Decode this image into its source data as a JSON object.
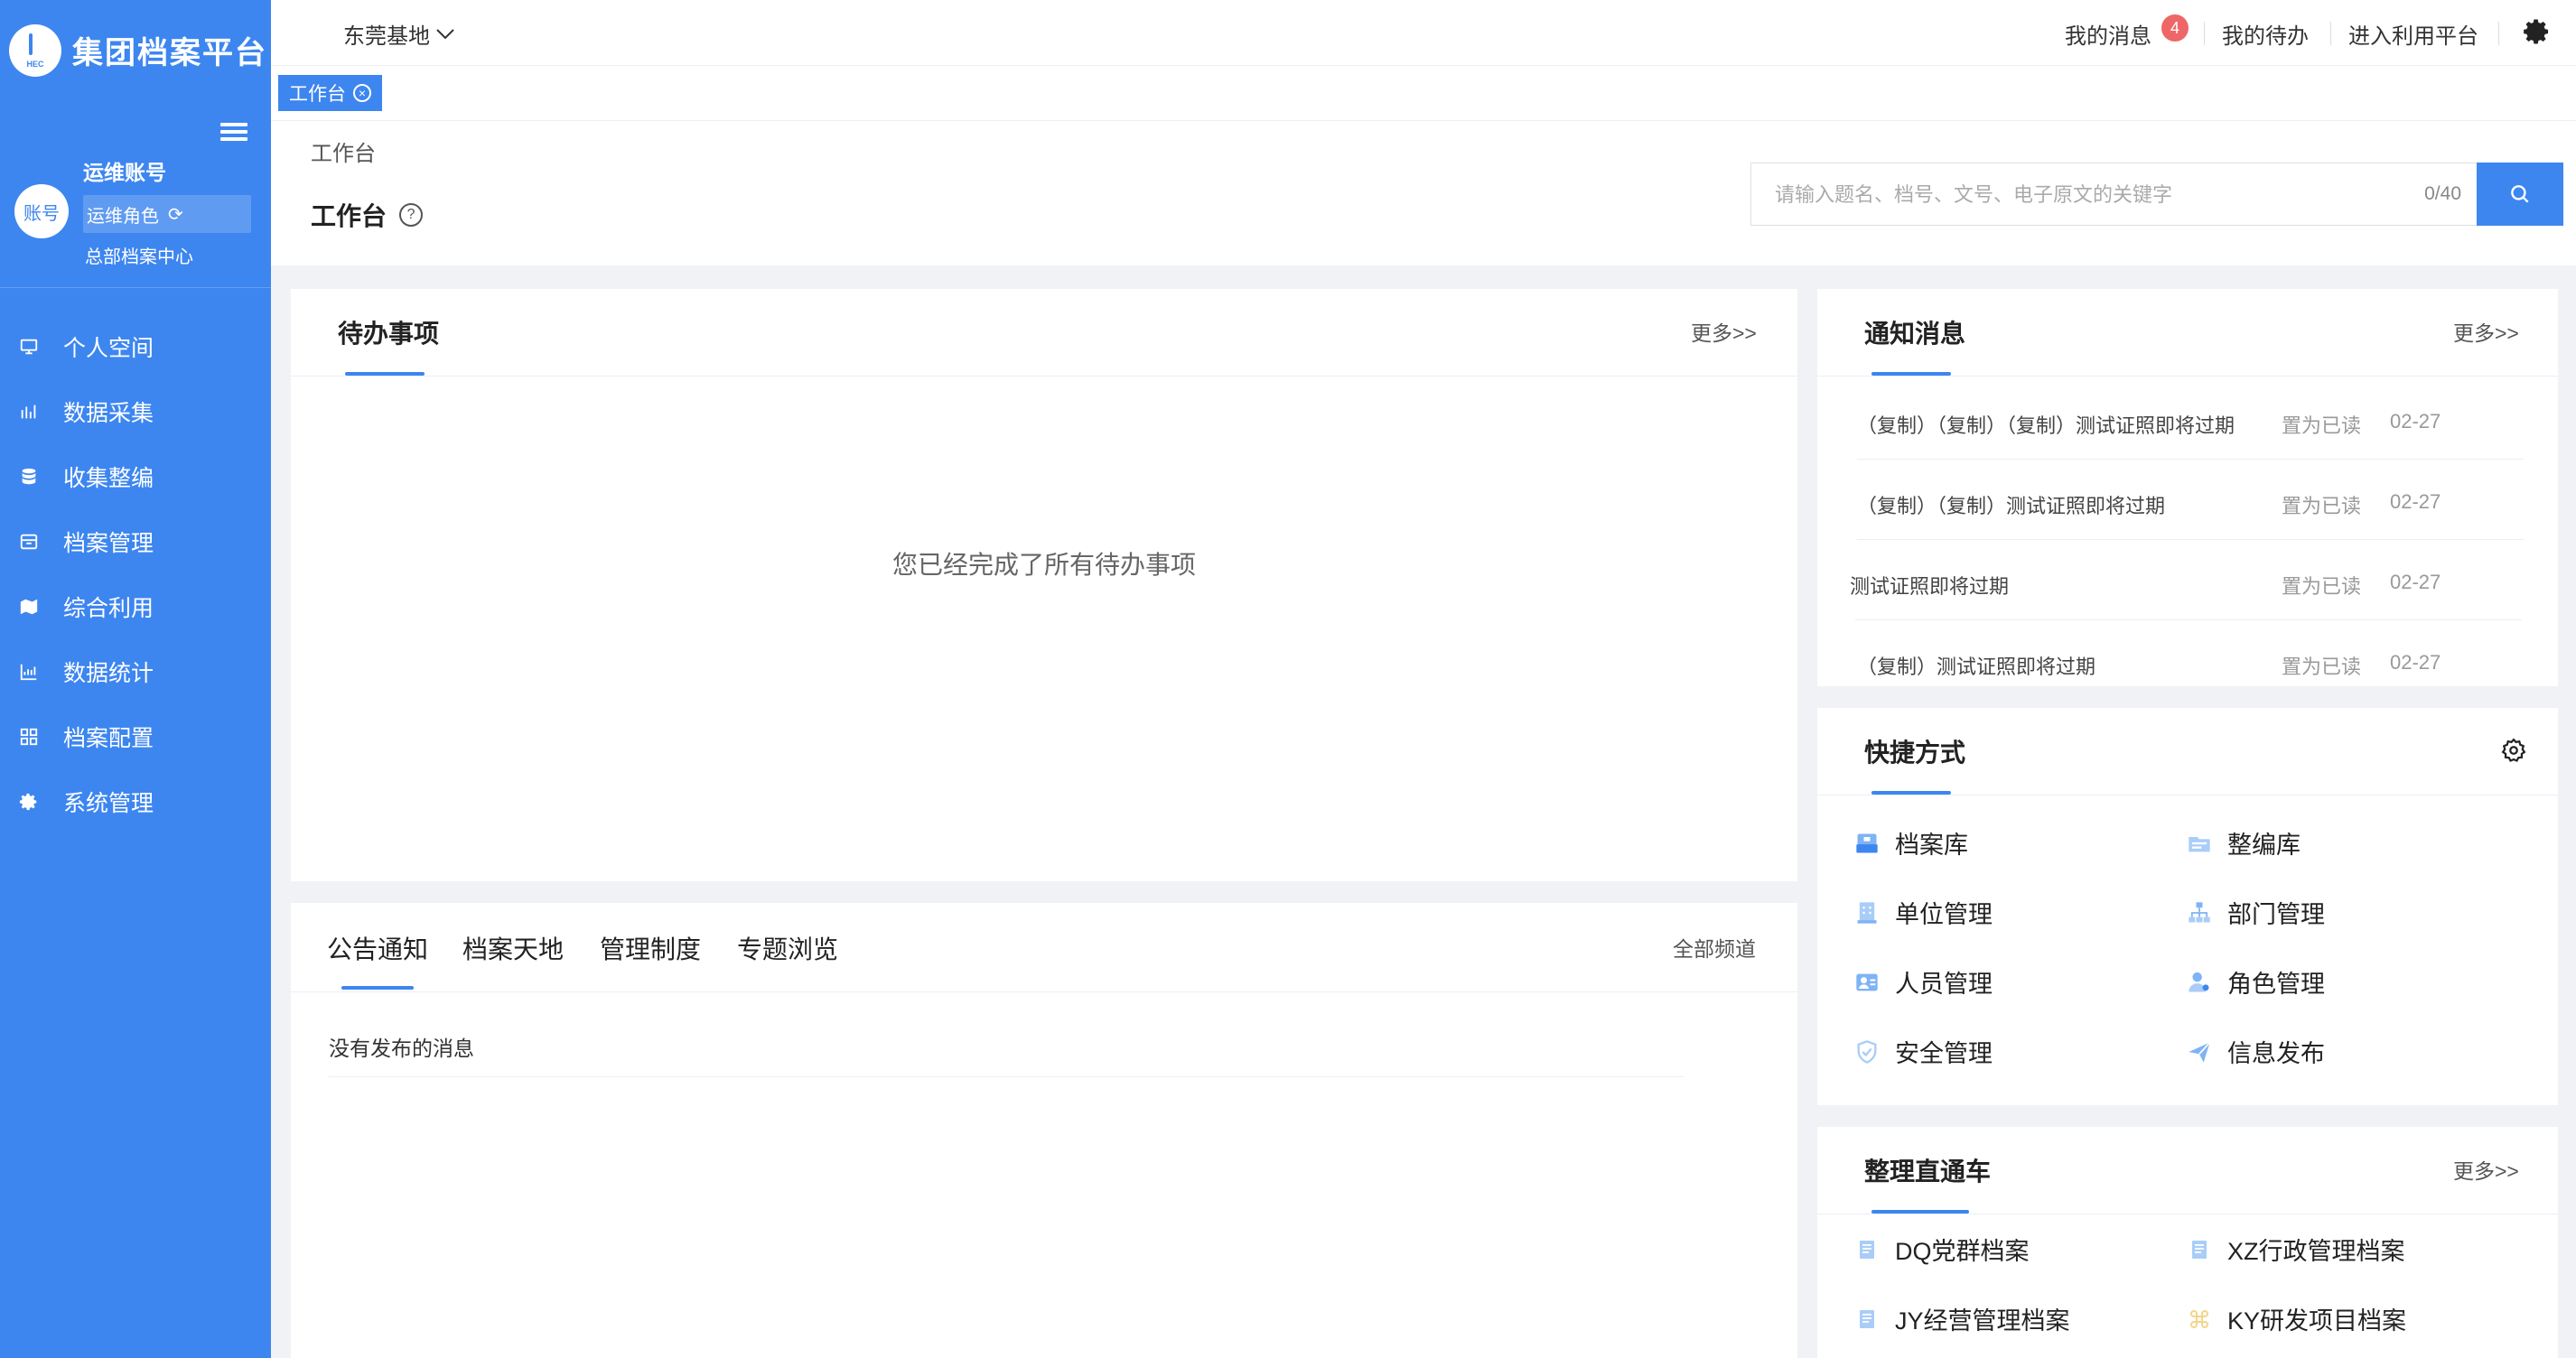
{
  "sidebar": {
    "logo_text": "集团档案平台",
    "user": {
      "avatar_text": "账号",
      "name": "运维账号",
      "role": "运维角色",
      "org": "总部档案中心"
    },
    "items": [
      {
        "label": "个人空间",
        "icon": "monitor-icon"
      },
      {
        "label": "数据采集",
        "icon": "collect-icon"
      },
      {
        "label": "收集整编",
        "icon": "database-icon"
      },
      {
        "label": "档案管理",
        "icon": "archive-box-icon"
      },
      {
        "label": "综合利用",
        "icon": "map-icon"
      },
      {
        "label": "数据统计",
        "icon": "bar-chart-icon"
      },
      {
        "label": "档案配置",
        "icon": "grid-icon"
      },
      {
        "label": "系统管理",
        "icon": "gear-icon"
      }
    ]
  },
  "topbar": {
    "base": "东莞基地",
    "messages": "我的消息",
    "message_count": "4",
    "todo": "我的待办",
    "enter_platform": "进入利用平台"
  },
  "tabs": [
    {
      "label": "工作台"
    }
  ],
  "header": {
    "breadcrumb": "工作台",
    "title": "工作台",
    "help": "?",
    "search": {
      "placeholder": "请输入题名、档号、文号、电子原文的关键字",
      "value": "",
      "counter": "0/40"
    }
  },
  "todo_card": {
    "title": "待办事项",
    "more": "更多>>",
    "empty": "您已经完成了所有待办事项"
  },
  "notice_card": {
    "tabs": [
      "公告通知",
      "档案天地",
      "管理制度",
      "专题浏览"
    ],
    "all_channels": "全部频道",
    "empty": "没有发布的消息"
  },
  "messages_card": {
    "title": "通知消息",
    "more": "更多>>",
    "rows": [
      {
        "title": "（复制）（复制）（复制）测试证照即将过期",
        "action": "置为已读",
        "date": "02-27"
      },
      {
        "title": "（复制）（复制）测试证照即将过期",
        "action": "置为已读",
        "date": "02-27"
      },
      {
        "title": "测试证照即将过期",
        "action": "置为已读",
        "date": "02-27"
      },
      {
        "title": "（复制）测试证照即将过期",
        "action": "置为已读",
        "date": "02-27"
      }
    ]
  },
  "shortcuts_card": {
    "title": "快捷方式",
    "items": [
      {
        "label": "档案库",
        "icon": "archive-library-icon"
      },
      {
        "label": "整编库",
        "icon": "folder-library-icon"
      },
      {
        "label": "单位管理",
        "icon": "building-icon"
      },
      {
        "label": "部门管理",
        "icon": "org-chart-icon"
      },
      {
        "label": "人员管理",
        "icon": "person-card-icon"
      },
      {
        "label": "角色管理",
        "icon": "user-role-icon"
      },
      {
        "label": "安全管理",
        "icon": "shield-icon"
      },
      {
        "label": "信息发布",
        "icon": "paper-plane-icon"
      }
    ]
  },
  "direct_card": {
    "title": "整理直通车",
    "more": "更多>>",
    "items": [
      {
        "label": "DQ党群档案",
        "icon": "document-icon"
      },
      {
        "label": "XZ行政管理档案",
        "icon": "document-icon"
      },
      {
        "label": "JY经营管理档案",
        "icon": "document-icon"
      },
      {
        "label": "KY研发项目档案",
        "icon": "command-icon"
      }
    ]
  },
  "colors": {
    "primary": "#3d86f0",
    "badge": "#ee6666",
    "background": "#f0f2f5"
  }
}
